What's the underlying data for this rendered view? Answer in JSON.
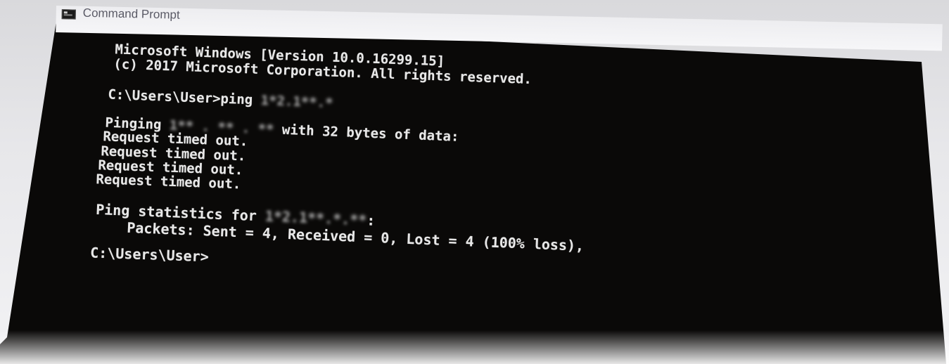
{
  "window": {
    "title": "Command Prompt",
    "icon": "console-icon"
  },
  "console": {
    "banner_line1": "Microsoft Windows [Version 10.0.16299.15]",
    "banner_line2": "(c) 2017 Microsoft Corporation. All rights reserved.",
    "ping_command_prompt": "C:\\Users\\User>ping ",
    "ping_command_target_obscured": "1*2.1**.*",
    "pinging_prefix": "Pinging ",
    "pinging_target_obscured": "1** . ** . **",
    "pinging_suffix": " with 32 bytes of data:",
    "reply_lines": [
      "Request timed out.",
      "Request timed out.",
      "Request timed out.",
      "Request timed out."
    ],
    "stats_prefix": "Ping statistics for ",
    "stats_target_obscured": "1*2.1**.*.**",
    "stats_suffix": ":",
    "packets_line": "    Packets: Sent = 4, Received = 0, Lost = 4 (100% loss),",
    "final_prompt": "C:\\Users\\User>"
  },
  "colors": {
    "console_background": "#0a0908",
    "console_text": "#e8e8e8",
    "titlebar_background": "#f0f0f2",
    "title_text": "#5a5a66"
  }
}
